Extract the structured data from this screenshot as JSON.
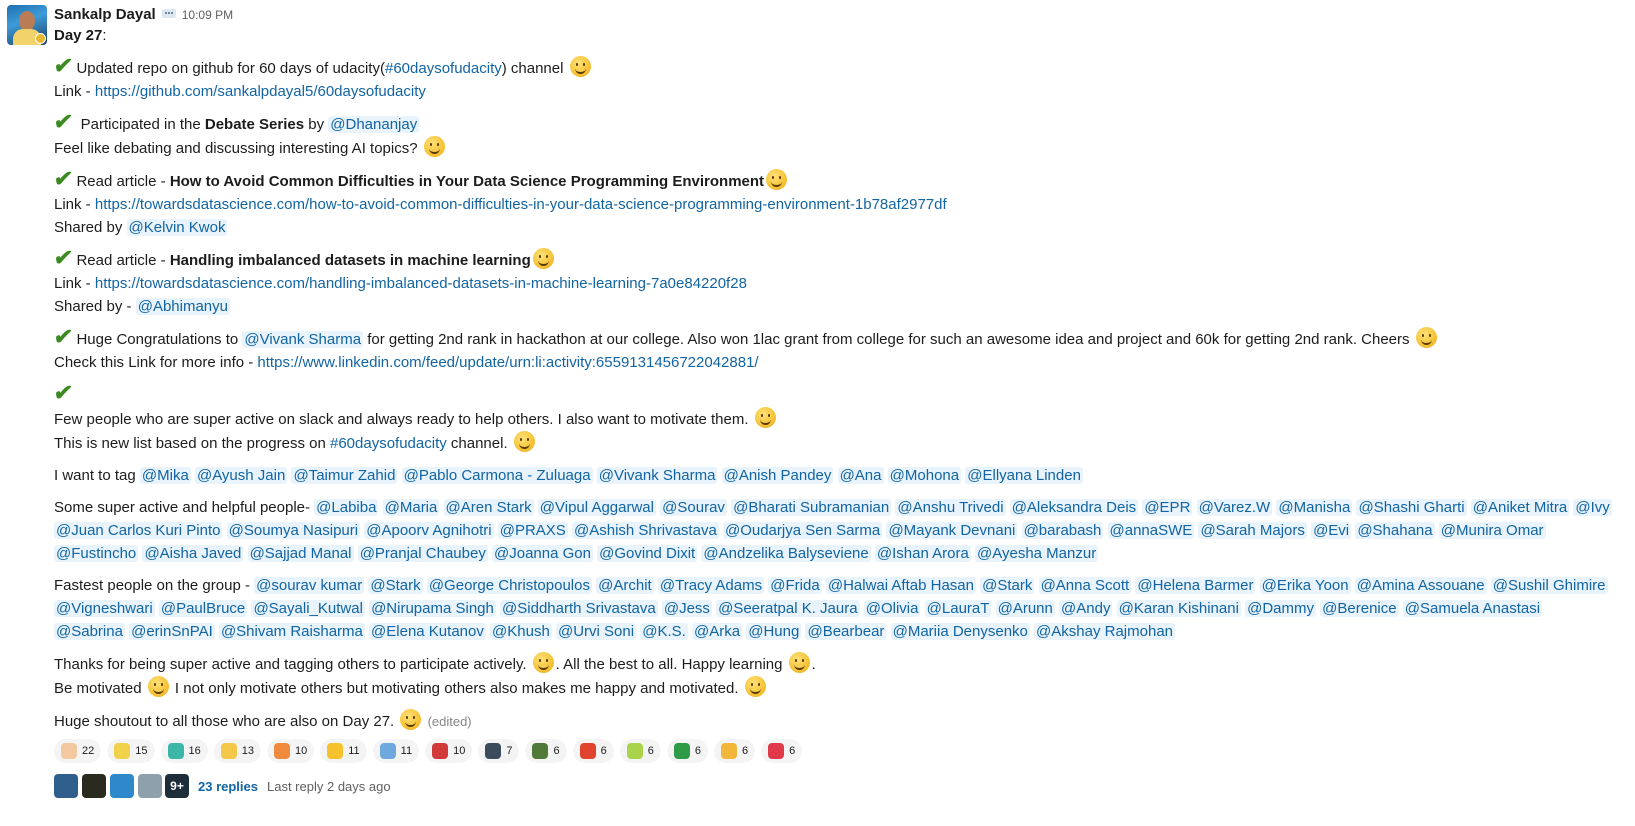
{
  "message": {
    "author": "Sankalp Dayal",
    "time": "10:09 PM",
    "day_label": "Day 27",
    "day_suffix": ":",
    "item1": {
      "pre": "Updated repo on github for 60 days of udacity(",
      "channel": "#60daysofudacity",
      "post": ")  channel",
      "link_label": "Link - ",
      "link": "https://github.com/sankalpdayal5/60daysofudacity"
    },
    "item2": {
      "pre": " Participated in the ",
      "bold": "Debate Series",
      "mid": " by ",
      "mention": "@Dhananjay",
      "line2": "Feel like debating and discussing interesting AI topics?"
    },
    "item3": {
      "pre": "Read article - ",
      "bold": "How to Avoid Common Difficulties in Your Data Science Programming Environment",
      "link_label": "Link - ",
      "link": "https://towardsdatascience.com/how-to-avoid-common-difficulties-in-your-data-science-programming-environment-1b78af2977df",
      "shared_label": "Shared by ",
      "mention": "@Kelvin Kwok"
    },
    "item4": {
      "pre": "Read article - ",
      "bold": "Handling imbalanced datasets in machine learning",
      "link_label": "Link - ",
      "link": "https://towardsdatascience.com/handling-imbalanced-datasets-in-machine-learning-7a0e84220f28",
      "shared_label": "Shared by - ",
      "mention": "@Abhimanyu"
    },
    "item5": {
      "pre": "Huge Congratulations to ",
      "mention": "@Vivank Sharma",
      "post": " for getting 2nd rank in hackathon at our college. Also won 1lac grant from college for such an awesome idea and project and 60k for getting 2nd rank. Cheers",
      "link_label": "Check this Link for more info - ",
      "link": "https://www.linkedin.com/feed/update/urn:li:activity:6559131456722042881/"
    },
    "item6": {
      "line1": "Few people who are super active on slack and always ready to help others. I also want to motivate them.",
      "line2_pre": "This is new list based on the progress on ",
      "channel": "#60daysofudacity",
      "line2_post": " channel."
    },
    "tag_label": "I want to tag ",
    "tag_mentions": [
      "@Mika",
      "@Ayush Jain",
      "@Taimur Zahid",
      "@Pablo Carmona - Zuluaga",
      "@Vivank Sharma",
      "@Anish Pandey",
      "@Ana",
      "@Mohona",
      "@Ellyana Linden"
    ],
    "helpful_label": "Some super active and helpful people- ",
    "helpful_mentions": [
      "@Labiba",
      "@Maria",
      "@Aren Stark",
      "@Vipul Aggarwal",
      "@Sourav",
      "@Bharati Subramanian",
      "@Anshu Trivedi",
      "@Aleksandra Deis",
      "@EPR",
      "@Varez.W",
      "@Manisha",
      "@Shashi Gharti",
      "@Aniket Mitra",
      "@Ivy",
      "@Juan Carlos Kuri Pinto",
      "@Soumya Nasipuri",
      "@Apoorv Agnihotri",
      "@PRAXS",
      "@Ashish Shrivastava",
      "@Oudarjya Sen Sarma",
      "@Mayank Devnani",
      "@barabash",
      "@annaSWE",
      "@Sarah Majors",
      "@Evi",
      "@Shahana",
      "@Munira Omar",
      "@Fustincho",
      "@Aisha Javed",
      "@Sajjad Manal",
      "@Pranjal Chaubey",
      "@Joanna Gon",
      "@Govind Dixit",
      "@Andzelika Balyseviene",
      "@Ishan Arora",
      "@Ayesha Manzur"
    ],
    "fastest_label": "Fastest people on the group - ",
    "fastest_mentions": [
      "@sourav kumar",
      "@Stark",
      "@George Christopoulos",
      "@Archit",
      "@Tracy Adams",
      "@Frida",
      "@Halwai Aftab Hasan",
      "@Stark",
      "@Anna Scott",
      "@Helena Barmer",
      "@Erika Yoon",
      "@Amina Assouane",
      "@Sushil Ghimire",
      "@Vigneshwari",
      "@PaulBruce",
      "@Sayali_Kutwal",
      "@Nirupama Singh",
      "@Siddharth Srivastava",
      "@Jess",
      "@Seeratpal K. Jaura",
      "@Olivia",
      "@LauraT",
      "@Arunn",
      "@Andy",
      "@Karan Kishinani",
      "@Dammy",
      "@Berenice",
      "@Samuela Anastasi",
      "@Sabrina",
      "@erinSnPAI",
      "@Shivam Raisharma",
      "@Elena Kutanov",
      "@Khush",
      "@Urvi Soni",
      "@K.S.",
      "@Arka",
      "@Hung",
      "@Bearbear",
      "@Mariia Denysenko",
      "@Akshay Rajmohan"
    ],
    "thanks_pre": "Thanks for being super active and tagging others to participate actively. ",
    "thanks_mid": ". All the best to all. Happy learning ",
    "thanks_post": ".",
    "motivated_pre": "Be motivated ",
    "motivated_post": " I not only motivate others but motivating others also makes me happy and motivated.",
    "shoutout": "Huge shoutout to all those who are also on Day 27.",
    "edited": "(edited)"
  },
  "reactions": [
    {
      "icon": "thumbs-up-icon",
      "count": "22",
      "color": "#f3c9a0"
    },
    {
      "icon": "warning-icon",
      "count": "15",
      "color": "#f2d24b"
    },
    {
      "icon": "blob-icon",
      "count": "16",
      "color": "#3bb6a8"
    },
    {
      "icon": "shocked-face-icon",
      "count": "13",
      "color": "#f5c74a"
    },
    {
      "icon": "party-popper-icon",
      "count": "10",
      "color": "#f08a3c"
    },
    {
      "icon": "star-icon",
      "count": "11",
      "color": "#f5c22e"
    },
    {
      "icon": "thank-you-icon",
      "count": "11",
      "color": "#6fa8dc"
    },
    {
      "icon": "stop-icon",
      "count": "10",
      "color": "#d23a3a"
    },
    {
      "icon": "penguin-icon",
      "count": "7",
      "color": "#3b4b5c"
    },
    {
      "icon": "game-icon",
      "count": "6",
      "color": "#4f7a3a"
    },
    {
      "icon": "fire-heart-icon",
      "count": "6",
      "color": "#e0442f"
    },
    {
      "icon": "green-square-icon",
      "count": "6",
      "color": "#a9d34a"
    },
    {
      "icon": "green-spin-icon",
      "count": "6",
      "color": "#2f9a48"
    },
    {
      "icon": "nerd-face-icon",
      "count": "6",
      "color": "#f2b63a"
    },
    {
      "icon": "red-swirl-icon",
      "count": "6",
      "color": "#e03a4a"
    }
  ],
  "thread": {
    "avatar_colors": [
      "#2f5f8c",
      "#2a2a1e",
      "#2e88c9",
      "#8fa0ad"
    ],
    "more_label": "9+",
    "replies": "23 replies",
    "last_reply": "Last reply 2 days ago"
  }
}
